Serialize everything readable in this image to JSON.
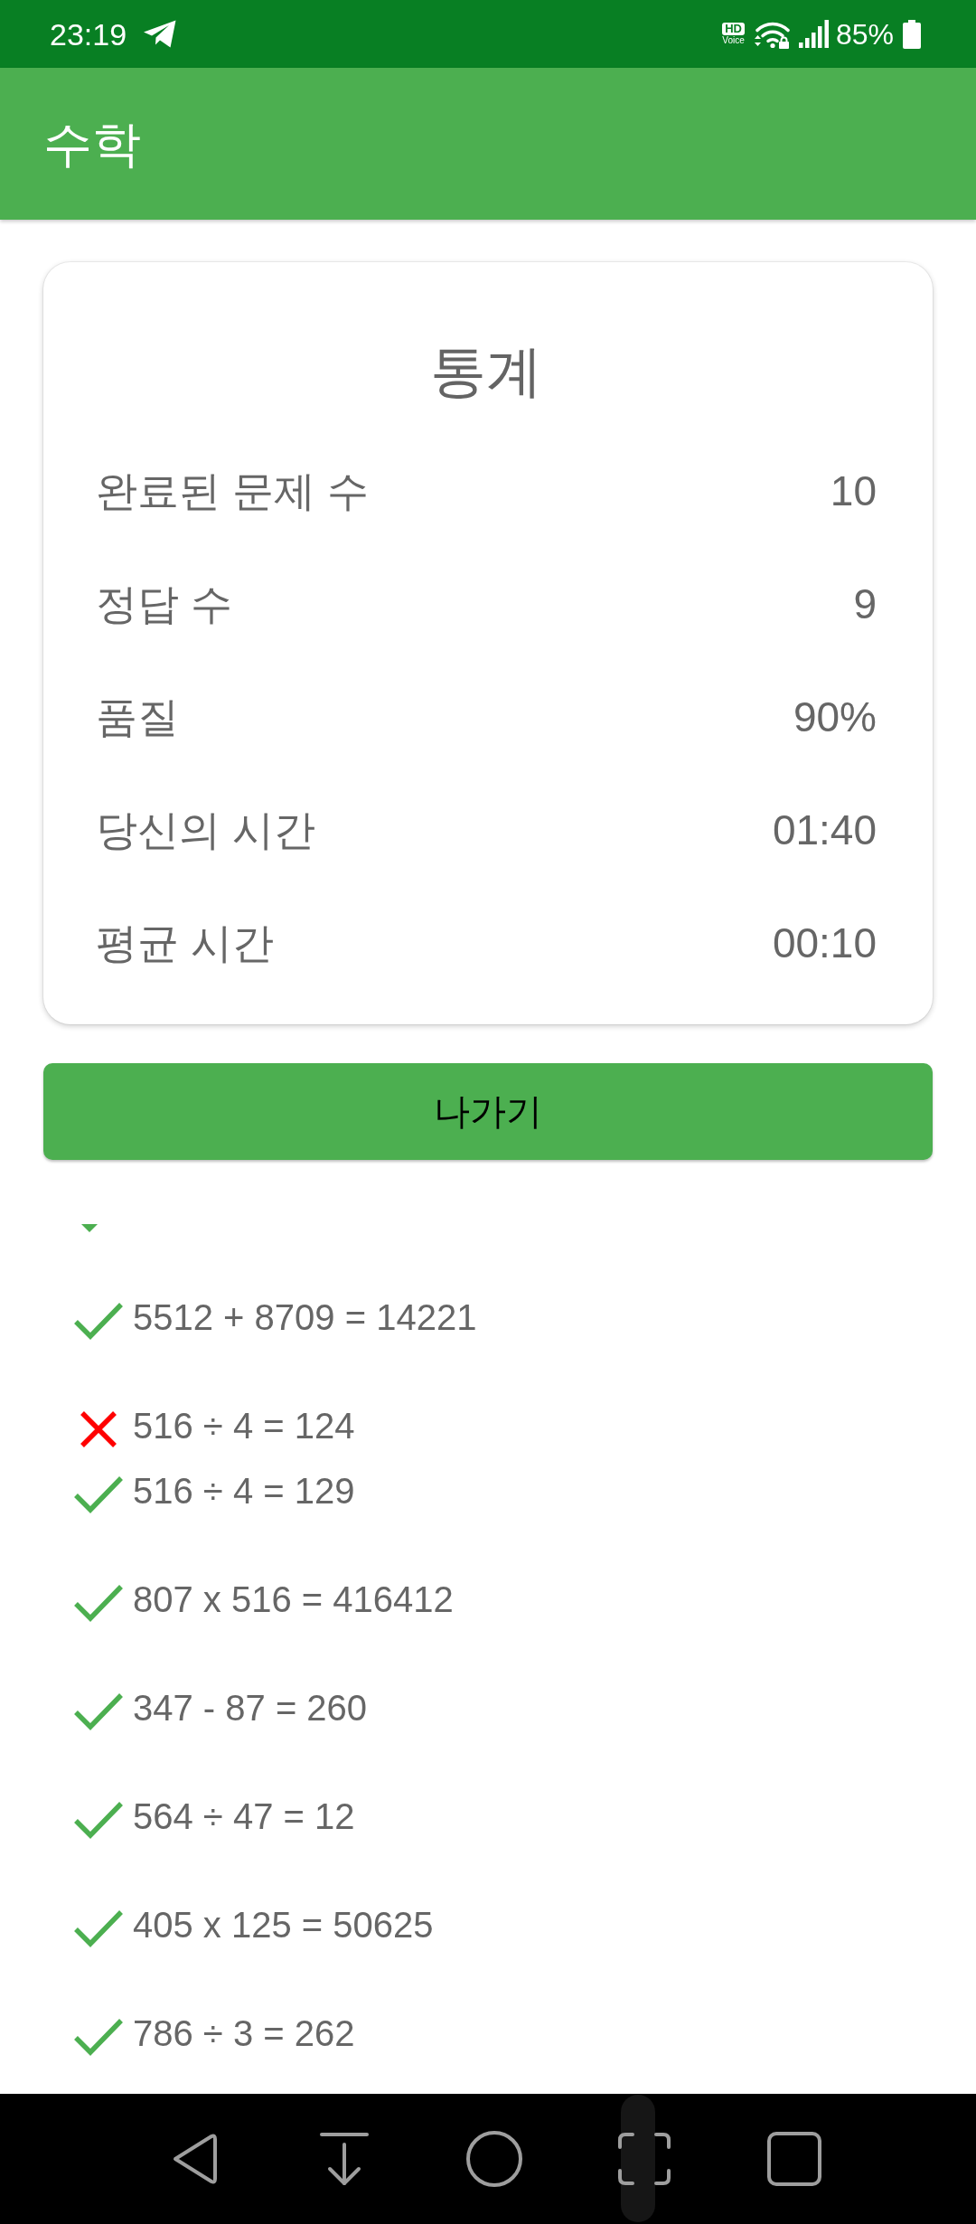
{
  "status_bar": {
    "time": "23:19",
    "hd_label": "HD",
    "voice_label": "Voice",
    "battery": "85%"
  },
  "app_bar": {
    "title": "수학"
  },
  "stats_card": {
    "title": "통계",
    "rows": [
      {
        "label": "완료된 문제 수",
        "value": "10"
      },
      {
        "label": "정답 수",
        "value": "9"
      },
      {
        "label": "품질",
        "value": "90%"
      },
      {
        "label": "당신의 시간",
        "value": "01:40"
      },
      {
        "label": "평균 시간",
        "value": "00:10"
      }
    ]
  },
  "exit_button": {
    "label": "나가기"
  },
  "history": {
    "expanded": true,
    "problems": [
      {
        "attempts": [
          {
            "text": "5512 + 8709 = 14221",
            "correct": true
          }
        ]
      },
      {
        "attempts": [
          {
            "text": "516 ÷ 4 = 124",
            "correct": false
          },
          {
            "text": "516 ÷ 4 = 129",
            "correct": true
          }
        ]
      },
      {
        "attempts": [
          {
            "text": "807 x 516 = 416412",
            "correct": true
          }
        ]
      },
      {
        "attempts": [
          {
            "text": "347 - 87 = 260",
            "correct": true
          }
        ]
      },
      {
        "attempts": [
          {
            "text": "564 ÷ 47 = 12",
            "correct": true
          }
        ]
      },
      {
        "attempts": [
          {
            "text": "405 x 125 = 50625",
            "correct": true
          }
        ]
      },
      {
        "attempts": [
          {
            "text": "786 ÷ 3 = 262",
            "correct": true
          }
        ]
      }
    ]
  }
}
